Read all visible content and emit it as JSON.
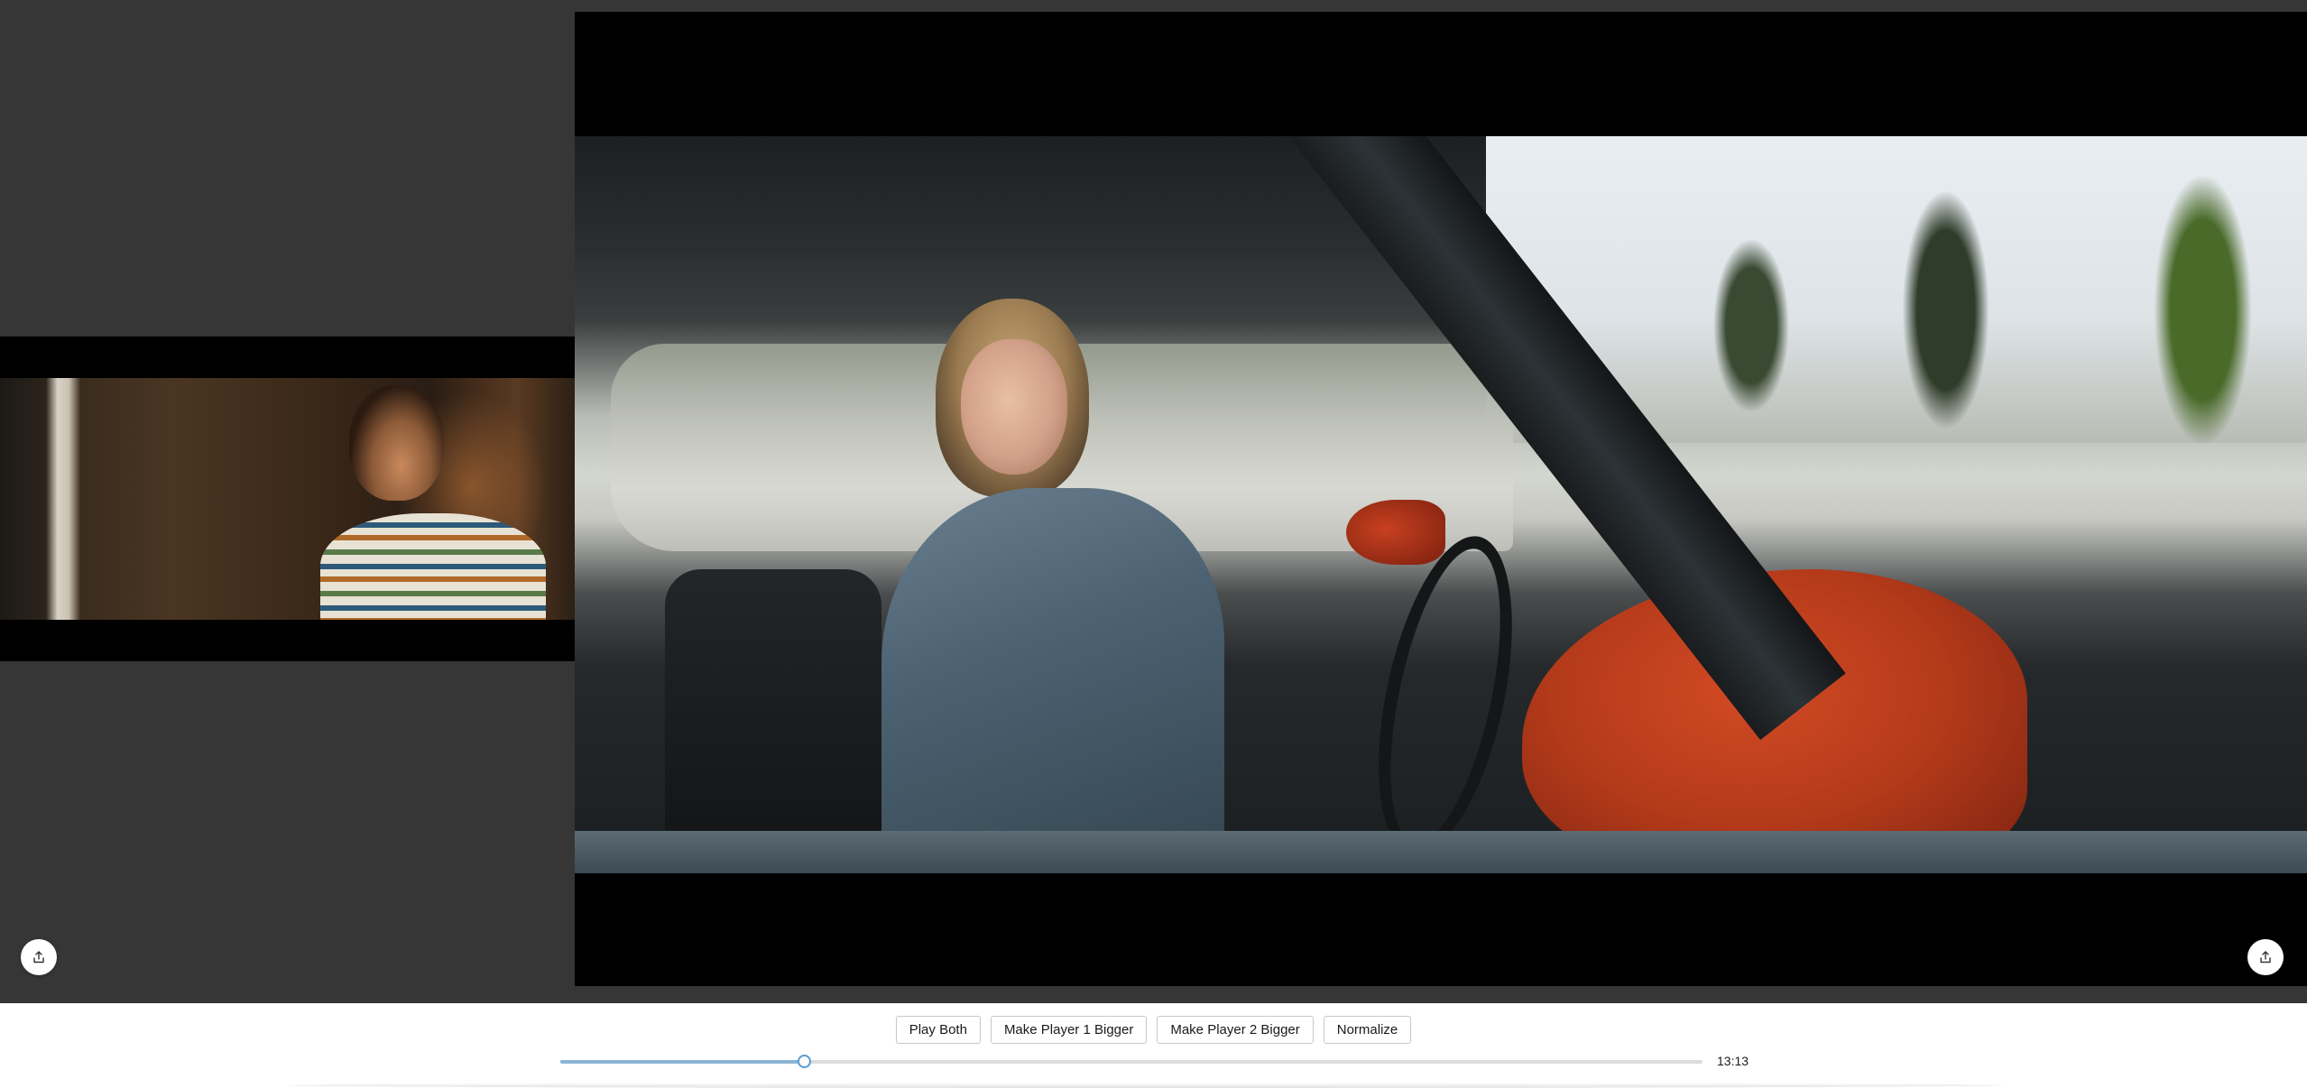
{
  "players": [
    {
      "name": "player-1",
      "share_icon": "share-icon"
    },
    {
      "name": "player-2",
      "share_icon": "share-icon"
    }
  ],
  "toolbar": {
    "play_both_label": "Play Both",
    "player1_bigger_label": "Make Player 1 Bigger",
    "player2_bigger_label": "Make Player 2 Bigger",
    "normalize_label": "Normalize"
  },
  "timeline": {
    "progress": 0.213,
    "time_label": "13:13"
  },
  "colors": {
    "background": "#363636",
    "accent": "#5b9bd1",
    "control_bar": "#ffffff"
  }
}
